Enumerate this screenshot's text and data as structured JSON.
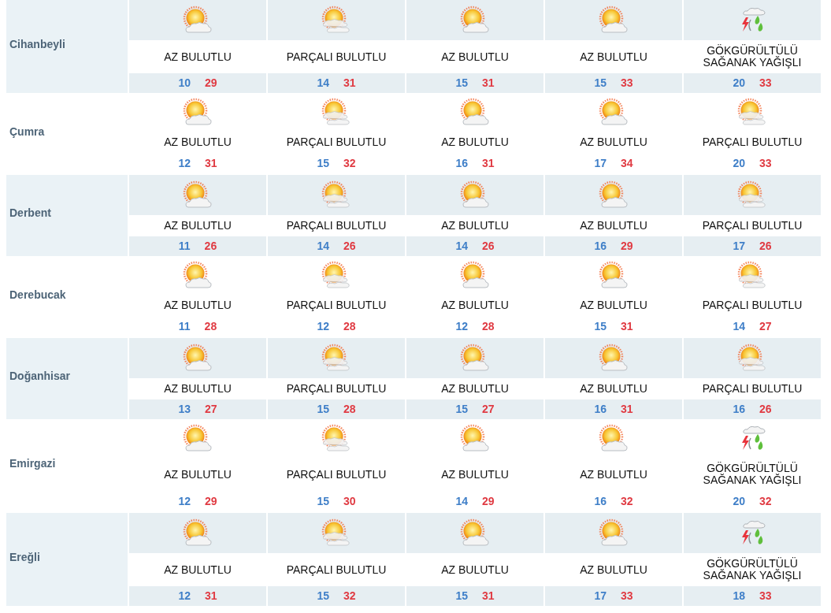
{
  "cities": [
    {
      "name": "Cihanbeyli",
      "days": [
        {
          "kind": "fewclouds",
          "condition": "AZ BULUTLU",
          "low": "10",
          "high": "29"
        },
        {
          "kind": "partlycloudy",
          "condition": "PARÇALI BULUTLU",
          "low": "14",
          "high": "31"
        },
        {
          "kind": "fewclouds",
          "condition": "AZ BULUTLU",
          "low": "15",
          "high": "31"
        },
        {
          "kind": "fewclouds",
          "condition": "AZ BULUTLU",
          "low": "15",
          "high": "33"
        },
        {
          "kind": "thunderstorm",
          "condition": "GÖKGÜRÜLTÜLÜ SAĞANAK YAĞIŞLI",
          "low": "20",
          "high": "33"
        }
      ]
    },
    {
      "name": "Çumra",
      "days": [
        {
          "kind": "fewclouds",
          "condition": "AZ BULUTLU",
          "low": "12",
          "high": "31"
        },
        {
          "kind": "partlycloudy",
          "condition": "PARÇALI BULUTLU",
          "low": "15",
          "high": "32"
        },
        {
          "kind": "fewclouds",
          "condition": "AZ BULUTLU",
          "low": "16",
          "high": "31"
        },
        {
          "kind": "fewclouds",
          "condition": "AZ BULUTLU",
          "low": "17",
          "high": "34"
        },
        {
          "kind": "partlycloudy",
          "condition": "PARÇALI BULUTLU",
          "low": "20",
          "high": "33"
        }
      ]
    },
    {
      "name": "Derbent",
      "days": [
        {
          "kind": "fewclouds",
          "condition": "AZ BULUTLU",
          "low": "11",
          "high": "26"
        },
        {
          "kind": "partlycloudy",
          "condition": "PARÇALI BULUTLU",
          "low": "14",
          "high": "26"
        },
        {
          "kind": "fewclouds",
          "condition": "AZ BULUTLU",
          "low": "14",
          "high": "26"
        },
        {
          "kind": "fewclouds",
          "condition": "AZ BULUTLU",
          "low": "16",
          "high": "29"
        },
        {
          "kind": "partlycloudy",
          "condition": "PARÇALI BULUTLU",
          "low": "17",
          "high": "26"
        }
      ]
    },
    {
      "name": "Derebucak",
      "days": [
        {
          "kind": "fewclouds",
          "condition": "AZ BULUTLU",
          "low": "11",
          "high": "28"
        },
        {
          "kind": "partlycloudy",
          "condition": "PARÇALI BULUTLU",
          "low": "12",
          "high": "28"
        },
        {
          "kind": "fewclouds",
          "condition": "AZ BULUTLU",
          "low": "12",
          "high": "28"
        },
        {
          "kind": "fewclouds",
          "condition": "AZ BULUTLU",
          "low": "15",
          "high": "31"
        },
        {
          "kind": "partlycloudy",
          "condition": "PARÇALI BULUTLU",
          "low": "14",
          "high": "27"
        }
      ]
    },
    {
      "name": "Doğanhisar",
      "days": [
        {
          "kind": "fewclouds",
          "condition": "AZ BULUTLU",
          "low": "13",
          "high": "27"
        },
        {
          "kind": "partlycloudy",
          "condition": "PARÇALI BULUTLU",
          "low": "15",
          "high": "28"
        },
        {
          "kind": "fewclouds",
          "condition": "AZ BULUTLU",
          "low": "15",
          "high": "27"
        },
        {
          "kind": "fewclouds",
          "condition": "AZ BULUTLU",
          "low": "16",
          "high": "31"
        },
        {
          "kind": "partlycloudy",
          "condition": "PARÇALI BULUTLU",
          "low": "16",
          "high": "26"
        }
      ]
    },
    {
      "name": "Emirgazi",
      "days": [
        {
          "kind": "fewclouds",
          "condition": "AZ BULUTLU",
          "low": "12",
          "high": "29"
        },
        {
          "kind": "partlycloudy",
          "condition": "PARÇALI BULUTLU",
          "low": "15",
          "high": "30"
        },
        {
          "kind": "fewclouds",
          "condition": "AZ BULUTLU",
          "low": "14",
          "high": "29"
        },
        {
          "kind": "fewclouds",
          "condition": "AZ BULUTLU",
          "low": "16",
          "high": "32"
        },
        {
          "kind": "thunderstorm",
          "condition": "GÖKGÜRÜLTÜLÜ SAĞANAK YAĞIŞLI",
          "low": "20",
          "high": "32"
        }
      ]
    },
    {
      "name": "Ereğli",
      "days": [
        {
          "kind": "fewclouds",
          "condition": "AZ BULUTLU",
          "low": "12",
          "high": "31"
        },
        {
          "kind": "partlycloudy",
          "condition": "PARÇALI BULUTLU",
          "low": "15",
          "high": "32"
        },
        {
          "kind": "fewclouds",
          "condition": "AZ BULUTLU",
          "low": "15",
          "high": "31"
        },
        {
          "kind": "fewclouds",
          "condition": "AZ BULUTLU",
          "low": "17",
          "high": "33"
        },
        {
          "kind": "thunderstorm",
          "condition": "GÖKGÜRÜLTÜLÜ SAĞANAK YAĞIŞLI",
          "low": "18",
          "high": "33"
        }
      ]
    }
  ]
}
